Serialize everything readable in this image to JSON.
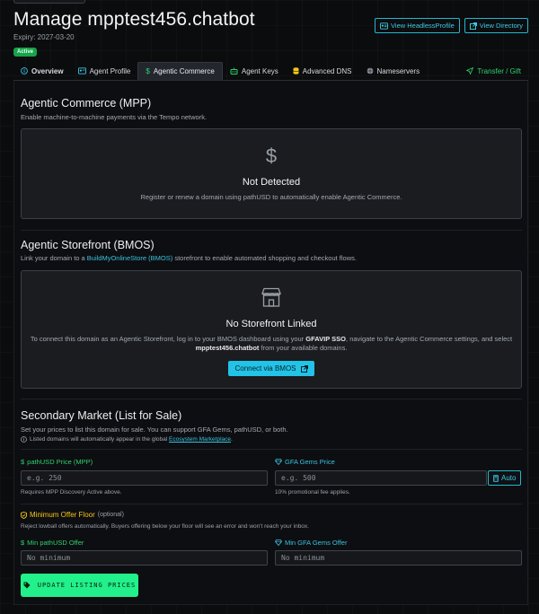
{
  "header": {
    "title": "Manage mpptest456.chatbot",
    "expiry": "Expiry: 2027-03-20",
    "status_badge": "Active",
    "buttons": [
      {
        "label": "View HeadlessProfile",
        "icon": "id-card-icon"
      },
      {
        "label": "View Directory",
        "icon": "external-link-icon"
      }
    ]
  },
  "tabs": [
    {
      "label": "Overview",
      "icon": "info-icon"
    },
    {
      "label": "Agent Profile",
      "icon": "id-card-icon"
    },
    {
      "label": "Agentic Commerce",
      "icon": "dollar-icon"
    },
    {
      "label": "Agent Keys",
      "icon": "robot-icon"
    },
    {
      "label": "Advanced DNS",
      "icon": "database-icon"
    },
    {
      "label": "Nameservers",
      "icon": "globe-icon"
    },
    {
      "label": "Transfer / Gift",
      "icon": "send-icon"
    }
  ],
  "active_tab": "Agentic Commerce",
  "mpp": {
    "title": "Agentic Commerce (MPP)",
    "description": "Enable machine-to-machine payments via the Tempo network.",
    "card_icon": "$",
    "card_title": "Not Detected",
    "card_desc": "Register or renew a domain using pathUSD to automatically enable Agentic Commerce."
  },
  "storefront": {
    "title": "Agentic Storefront (BMOS)",
    "desc_prefix": "Link your domain to a ",
    "desc_link": "BuildMyOnlineStore (BMOS)",
    "desc_suffix": " storefront to enable automated shopping and checkout flows.",
    "card_title": "No Storefront Linked",
    "card_desc_1": "To connect this domain as an Agentic Storefront, log in to your BMOS dashboard using your ",
    "card_desc_sso": "GFAVIP SSO",
    "card_desc_2": ", navigate to the Agentic Commerce settings, and select",
    "card_domain": "mpptest456.chatbot",
    "card_desc_3": " from your available domains.",
    "connect_label": "Connect via BMOS"
  },
  "market": {
    "title": "Secondary Market (List for Sale)",
    "description": "Set your prices to list this domain for sale. You can support GFA Gems, pathUSD, or both.",
    "note_prefix": "Listed domains will automatically appear in the global ",
    "note_link": "Ecosystem Marketplace",
    "note_suffix": ".",
    "pathusd_label": "pathUSD Price (MPP)",
    "pathusd_placeholder": "e.g. 250",
    "pathusd_help": "Requires MPP Discovery Active above.",
    "gems_label": "GFA Gems Price",
    "gems_placeholder": "e.g. 500",
    "gems_help": "10% promotional fee applies.",
    "auto_label": "Auto",
    "floor_title": "Minimum Offer Floor",
    "floor_optional": "(optional)",
    "floor_desc": "Reject lowball offers automatically. Buyers offering below your floor will see an error and won't reach your inbox.",
    "min_pathusd_label": "Min pathUSD Offer",
    "min_pathusd_placeholder": "No minimum",
    "min_gems_label": "Min GFA Gems Offer",
    "min_gems_placeholder": "No minimum",
    "update_label": "UPDATE LISTING PRICES"
  },
  "colors": {
    "accent": "#22b8cf",
    "success": "#22f08a",
    "warning": "#f5c518",
    "badge": "#16a34a"
  }
}
